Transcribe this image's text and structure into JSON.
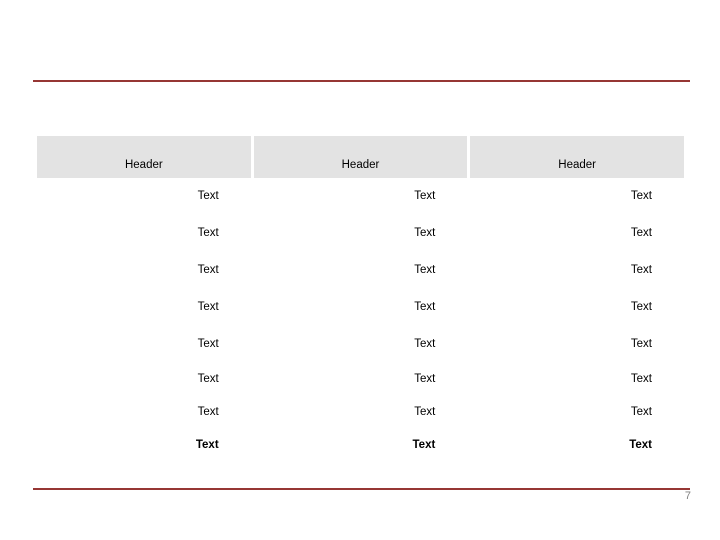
{
  "slide": {
    "page_number": "7",
    "accent_color": "#963634",
    "header_fill": "#E3E3E3",
    "background_color": "#FFFFFF",
    "page_number_color": "#808080"
  },
  "table": {
    "columns": [
      {
        "header": "Header"
      },
      {
        "header": "Header"
      },
      {
        "header": "Header"
      }
    ],
    "rows": [
      {
        "emphasis": "normal",
        "cells": [
          "Text",
          "Text",
          "Text"
        ]
      },
      {
        "emphasis": "normal",
        "cells": [
          "Text",
          "Text",
          "Text"
        ]
      },
      {
        "emphasis": "normal",
        "cells": [
          "Text",
          "Text",
          "Text"
        ]
      },
      {
        "emphasis": "normal",
        "cells": [
          "Text",
          "Text",
          "Text"
        ]
      },
      {
        "emphasis": "normal",
        "cells": [
          "Text",
          "Text",
          "Text"
        ]
      },
      {
        "emphasis": "normal",
        "cells": [
          "Text",
          "Text",
          "Text"
        ]
      },
      {
        "emphasis": "normal",
        "cells": [
          "Text",
          "Text",
          "Text"
        ]
      },
      {
        "emphasis": "bold",
        "cells": [
          "Text",
          "Text",
          "Text"
        ]
      }
    ]
  }
}
